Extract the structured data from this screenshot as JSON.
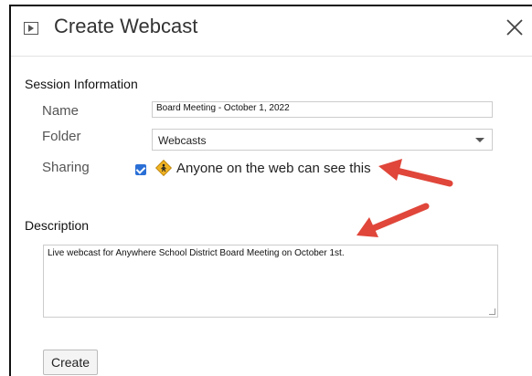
{
  "dialog": {
    "title": "Create Webcast",
    "icons": {
      "header": "play-icon",
      "close": "close-icon"
    }
  },
  "session": {
    "heading": "Session Information",
    "name_label": "Name",
    "name_value": "Board Meeting - October 1, 2022",
    "folder_label": "Folder",
    "folder_value": "Webcasts",
    "sharing_label": "Sharing",
    "sharing_checked": true,
    "sharing_text": "Anyone on the web can see this"
  },
  "description": {
    "heading": "Description",
    "value": "Live webcast for Anywhere School District Board Meeting on October 1st."
  },
  "actions": {
    "create_label": "Create"
  },
  "colors": {
    "arrow": "#e0463a",
    "checkbox": "#2a6fd6",
    "share_icon": "#f0b323"
  }
}
